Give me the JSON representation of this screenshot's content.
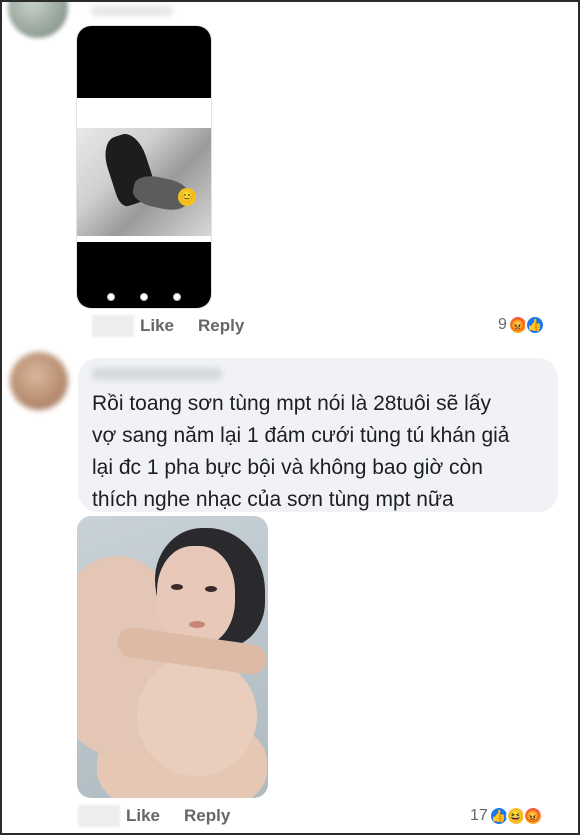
{
  "comment1": {
    "actions": {
      "like_label": "Like",
      "reply_label": "Reply"
    },
    "reactions": {
      "count": "9",
      "icons": [
        "angry-icon",
        "like-icon"
      ]
    }
  },
  "comment2": {
    "text_lines": [
      "Rồi toang sơn tùng mpt nói là 28tuôi sẽ lấy",
      "vợ sang năm lại 1 đám cưới tùng tú khán giả",
      "lại đc 1 pha bực bội và không bao giờ còn",
      "thích nghe nhạc của sơn tùng mpt nữa"
    ],
    "actions": {
      "like_label": "Like",
      "reply_label": "Reply"
    },
    "reactions": {
      "count": "17",
      "icons": [
        "like-icon",
        "haha-icon",
        "angry-icon"
      ]
    }
  },
  "colors": {
    "bubble": "#f0f2f5",
    "action_text": "#65676b",
    "like_blue": "#1877f2"
  }
}
